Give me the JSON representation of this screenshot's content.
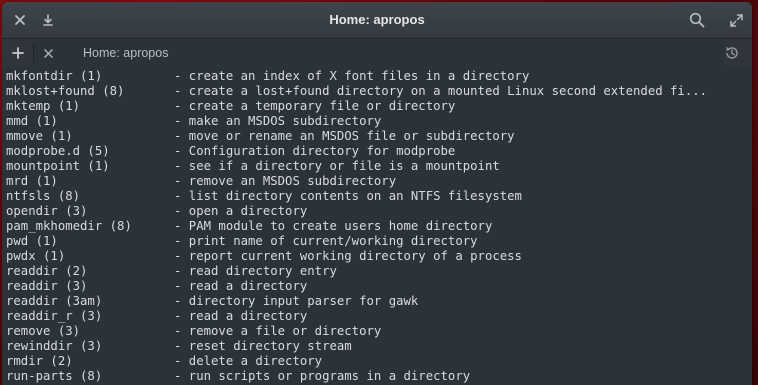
{
  "window": {
    "title": "Home: apropos"
  },
  "titlebar": {
    "close_icon": "close-icon",
    "download_icon": "download-icon",
    "search_icon": "search-icon",
    "maximize_icon": "maximize-icon"
  },
  "tabbar": {
    "new_tab_icon": "plus-icon",
    "tab_label": "Home: apropos",
    "tab_close_icon": "close-icon",
    "history_icon": "history-icon"
  },
  "colors": {
    "terminal_bg": "#2b3238",
    "terminal_fg": "#d9dcdf",
    "titlebar_bg": "#3a4047",
    "desktop_bg": "#7a0d10"
  },
  "terminal": {
    "lines": [
      {
        "cmd": "mkfontdir (1)",
        "desc": "- create an index of X font files in a directory"
      },
      {
        "cmd": "mklost+found (8)",
        "desc": "- create a lost+found directory on a mounted Linux second extended fi..."
      },
      {
        "cmd": "mktemp (1)",
        "desc": "- create a temporary file or directory"
      },
      {
        "cmd": "mmd (1)",
        "desc": "- make an MSDOS subdirectory"
      },
      {
        "cmd": "mmove (1)",
        "desc": "- move or rename an MSDOS file or subdirectory"
      },
      {
        "cmd": "modprobe.d (5)",
        "desc": "- Configuration directory for modprobe"
      },
      {
        "cmd": "mountpoint (1)",
        "desc": "- see if a directory or file is a mountpoint"
      },
      {
        "cmd": "mrd (1)",
        "desc": "- remove an MSDOS subdirectory"
      },
      {
        "cmd": "ntfsls (8)",
        "desc": "- list directory contents on an NTFS filesystem"
      },
      {
        "cmd": "opendir (3)",
        "desc": "- open a directory"
      },
      {
        "cmd": "pam_mkhomedir (8)",
        "desc": "- PAM module to create users home directory"
      },
      {
        "cmd": "pwd (1)",
        "desc": "- print name of current/working directory"
      },
      {
        "cmd": "pwdx (1)",
        "desc": "- report current working directory of a process"
      },
      {
        "cmd": "readdir (2)",
        "desc": "- read directory entry"
      },
      {
        "cmd": "readdir (3)",
        "desc": "- read a directory"
      },
      {
        "cmd": "readdir (3am)",
        "desc": "- directory input parser for gawk"
      },
      {
        "cmd": "readdir_r (3)",
        "desc": "- read a directory"
      },
      {
        "cmd": "remove (3)",
        "desc": "- remove a file or directory"
      },
      {
        "cmd": "rewinddir (3)",
        "desc": "- reset directory stream"
      },
      {
        "cmd": "rmdir (2)",
        "desc": "- delete a directory"
      },
      {
        "cmd": "run-parts (8)",
        "desc": "- run scripts or programs in a directory"
      }
    ]
  }
}
